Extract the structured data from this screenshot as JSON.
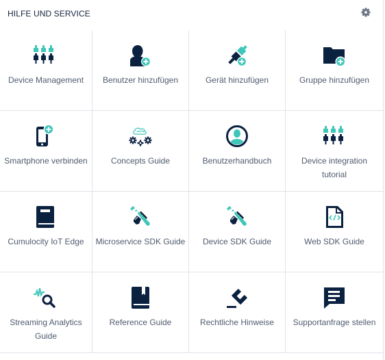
{
  "header": {
    "title": "HILFE UND SERVICE",
    "settings_icon": "gear-icon"
  },
  "colors": {
    "navy": "#0b2140",
    "teal": "#3ec6b9",
    "text": "#4f5b6e",
    "title": "#14233c",
    "border": "#e1e3e8",
    "gear": "#6b7384"
  },
  "tiles": [
    {
      "label": "Device Management",
      "icon": "plugs-icon"
    },
    {
      "label": "Benutzer hinzufügen",
      "icon": "add-user-icon"
    },
    {
      "label": "Gerät hinzufügen",
      "icon": "add-device-plug-icon"
    },
    {
      "label": "Gruppe hinzufügen",
      "icon": "add-folder-icon"
    },
    {
      "label": "Smartphone verbinden",
      "icon": "add-smartphone-icon"
    },
    {
      "label": "Concepts Guide",
      "icon": "cloud-gears-icon"
    },
    {
      "label": "Benutzerhandbuch",
      "icon": "user-circle-icon"
    },
    {
      "label": "Device integration tutorial",
      "icon": "plugs-icon"
    },
    {
      "label": "Cumulocity IoT Edge",
      "icon": "book-icon"
    },
    {
      "label": "Microservice SDK Guide",
      "icon": "wrench-hand-icon"
    },
    {
      "label": "Device SDK Guide",
      "icon": "wrench-hand-icon"
    },
    {
      "label": "Web SDK Guide",
      "icon": "code-file-icon"
    },
    {
      "label": "Streaming Analytics Guide",
      "icon": "analytics-search-icon"
    },
    {
      "label": "Reference Guide",
      "icon": "bookmark-book-icon"
    },
    {
      "label": "Rechtliche Hinweise",
      "icon": "gavel-icon"
    },
    {
      "label": "Supportanfrage stellen",
      "icon": "chat-message-icon"
    }
  ]
}
